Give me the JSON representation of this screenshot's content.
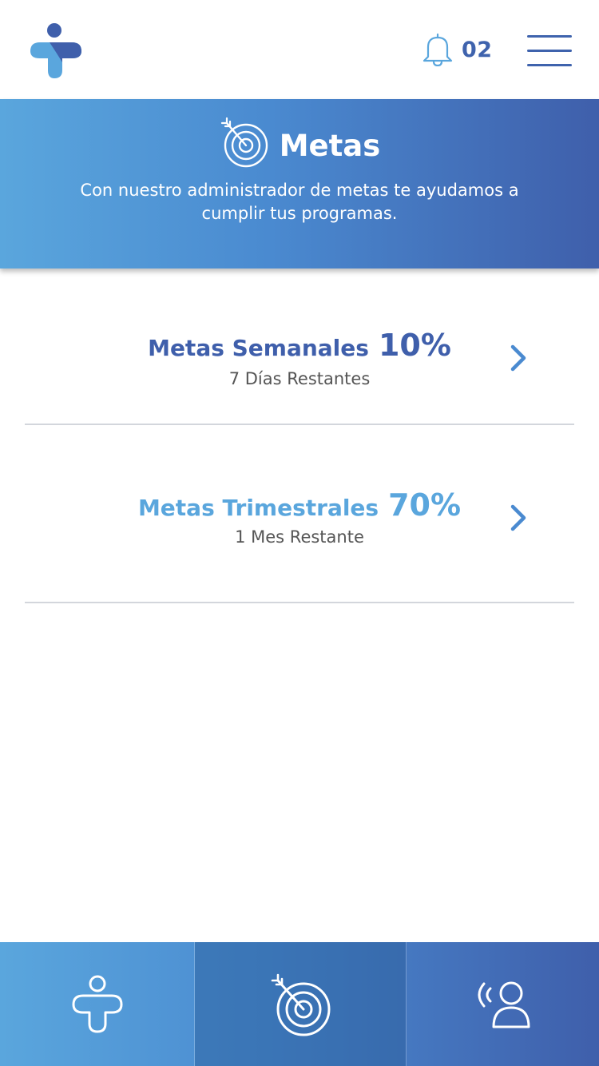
{
  "header": {
    "logo_icon": "app-logo-icon",
    "notification_icon": "bell-icon",
    "notification_count": "02",
    "menu_icon": "hamburger-menu-icon"
  },
  "hero": {
    "icon": "target-arrow-icon",
    "title": "Metas",
    "description": "Con nuestro administrador de metas te ayudamos a cumplir tus programas."
  },
  "goals": [
    {
      "name": "Metas Semanales",
      "percent": "10%",
      "remaining": "7 Días Restantes",
      "color": "#3f5fab",
      "chevron_icon": "chevron-right-icon"
    },
    {
      "name": "Metas Trimestrales",
      "percent": "70%",
      "remaining": "1 Mes Restante",
      "color": "#5aa6dd",
      "chevron_icon": "chevron-right-icon"
    }
  ],
  "bottom_nav": {
    "tabs": [
      {
        "icon": "person-health-icon",
        "active": false
      },
      {
        "icon": "target-arrow-icon",
        "active": true
      },
      {
        "icon": "person-broadcast-icon",
        "active": false
      }
    ]
  },
  "colors": {
    "primary_dark": "#3f5fab",
    "primary_light": "#5aa6dd",
    "text_gray": "#555555",
    "divider": "#d3d6dc"
  }
}
